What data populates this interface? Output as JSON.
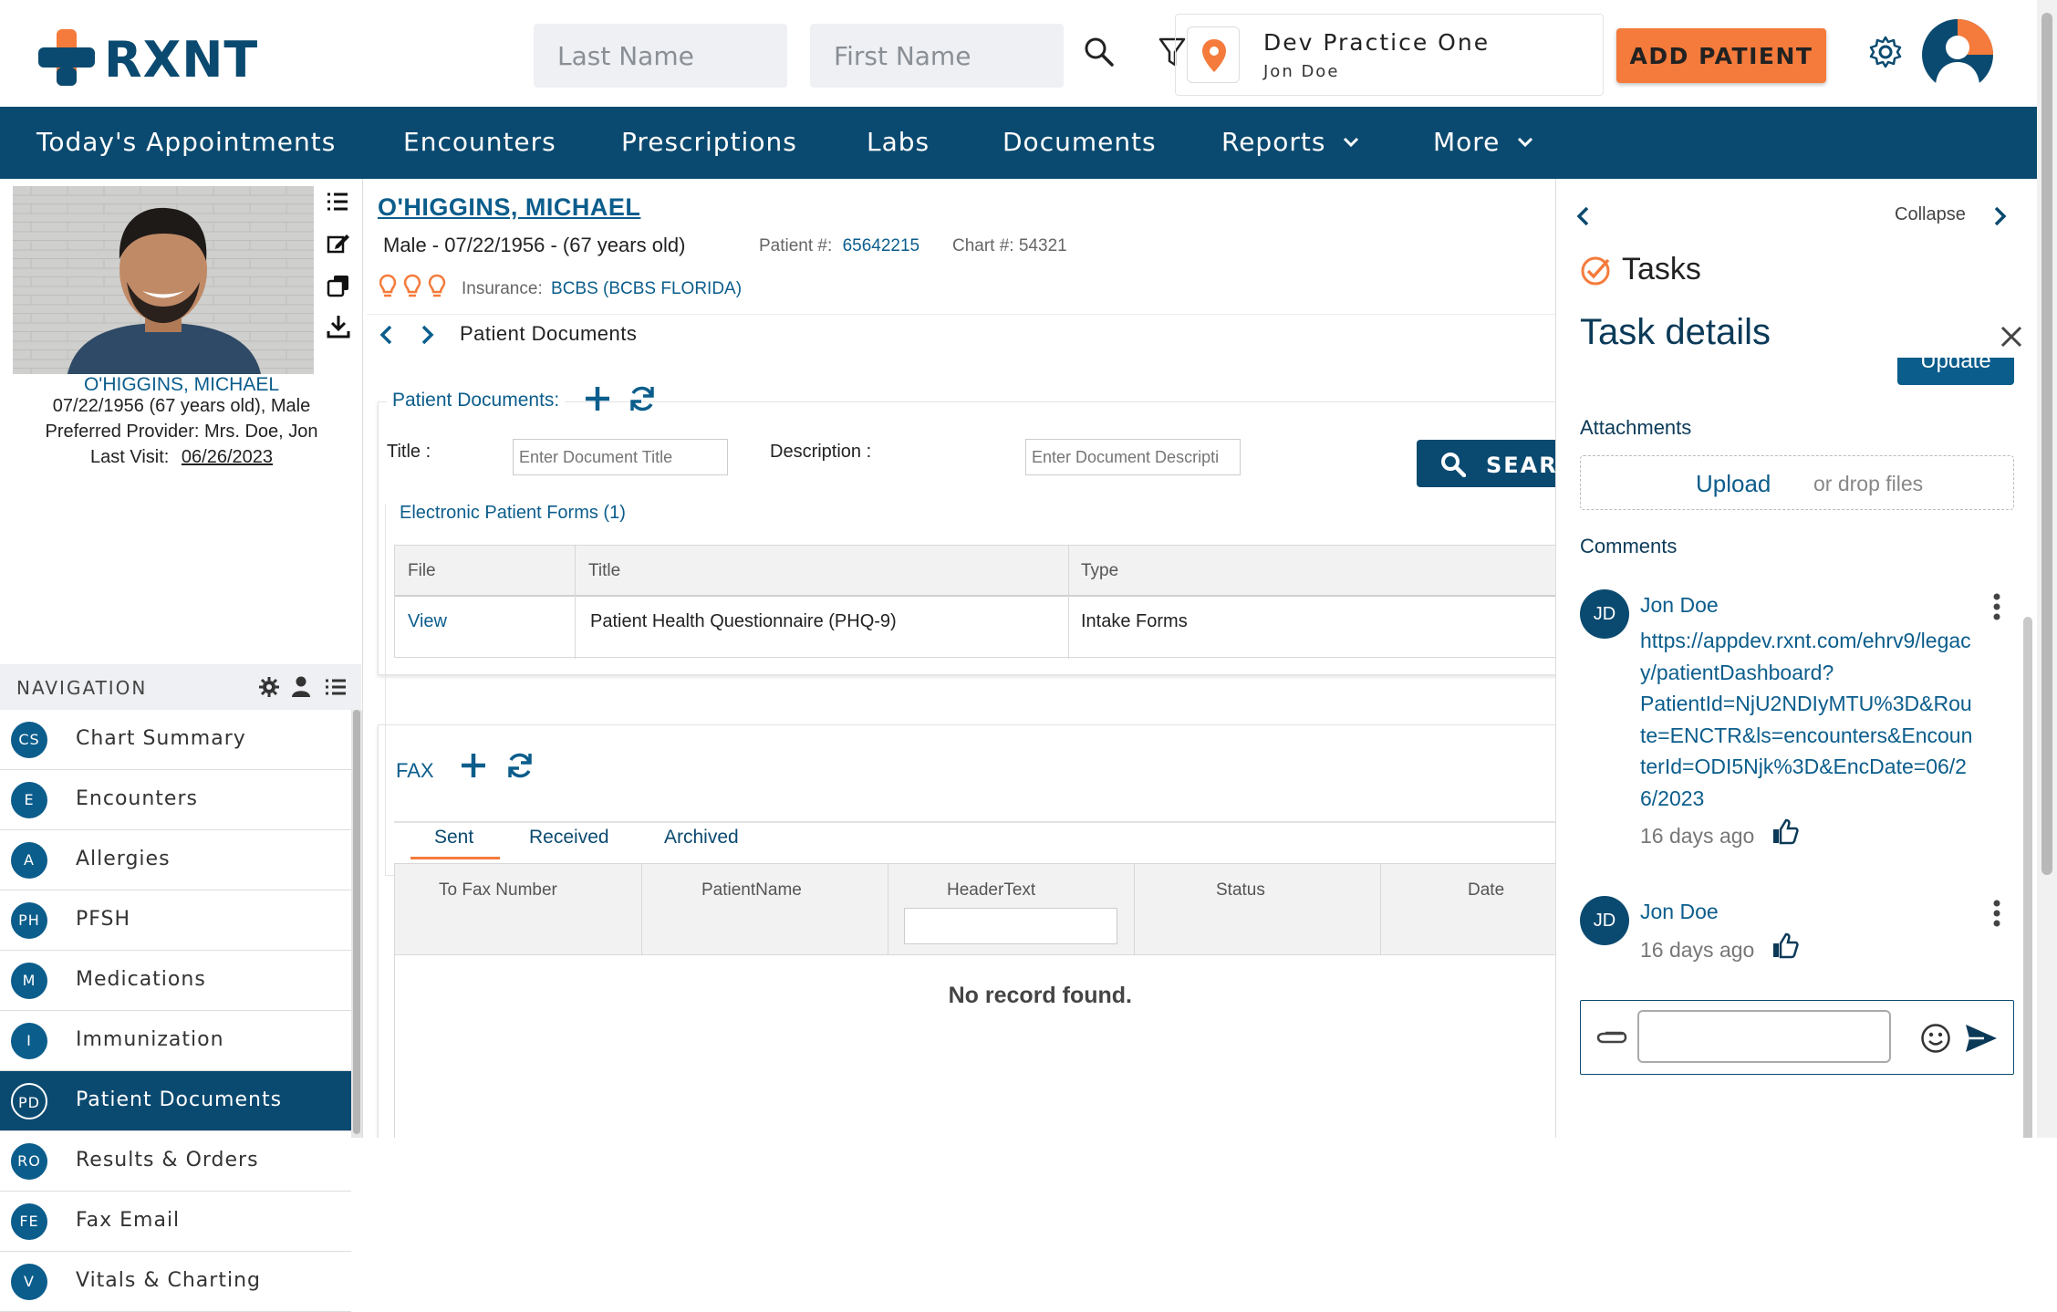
{
  "header": {
    "logo_text": "RXNT",
    "last_name_placeholder": "Last Name",
    "first_name_placeholder": "First Name",
    "practice_name": "Dev Practice One",
    "practice_user": "Jon Doe",
    "add_patient_label": "ADD PATIENT"
  },
  "nav": {
    "items": [
      "Today's Appointments",
      "Encounters",
      "Prescriptions",
      "Labs",
      "Documents",
      "Reports",
      "More"
    ]
  },
  "patient": {
    "name": "O'HIGGINS, MICHAEL",
    "card_name": "O'HIGGINS, MICHAEL",
    "dob_age_sex": "07/22/1956 (67 years old), Male",
    "preferred_provider": "Preferred Provider: Mrs. Doe, Jon",
    "last_visit_label": "Last Visit:",
    "last_visit_date": "06/26/2023",
    "demographics": "Male - 07/22/1956 - (67 years old)",
    "patient_num_label": "Patient #:",
    "patient_num": "65642215",
    "chart_num": "Chart #: 54321",
    "insurance_label": "Insurance:",
    "insurance_value": "BCBS (BCBS FLORIDA)"
  },
  "left_nav": {
    "heading": "NAVIGATION",
    "items": [
      {
        "abbr": "CS",
        "label": "Chart Summary"
      },
      {
        "abbr": "E",
        "label": "Encounters"
      },
      {
        "abbr": "A",
        "label": "Allergies"
      },
      {
        "abbr": "PH",
        "label": "PFSH"
      },
      {
        "abbr": "M",
        "label": "Medications"
      },
      {
        "abbr": "I",
        "label": "Immunization"
      },
      {
        "abbr": "PD",
        "label": "Patient Documents"
      },
      {
        "abbr": "RO",
        "label": "Results & Orders"
      },
      {
        "abbr": "FE",
        "label": "Fax Email"
      },
      {
        "abbr": "V",
        "label": "Vitals & Charting"
      }
    ]
  },
  "documents": {
    "breadcrumb": "Patient Documents",
    "section_title": "Patient Documents:",
    "title_label": "Title :",
    "title_placeholder": "Enter Document Title",
    "description_label": "Description :",
    "description_placeholder": "Enter Document Descripti",
    "search_label": "SEARC",
    "forms_heading": "Electronic Patient Forms (1)",
    "columns": [
      "File",
      "Title",
      "Type"
    ],
    "rows": [
      {
        "file": "View",
        "title": "Patient Health Questionnaire (PHQ-9)",
        "type": "Intake Forms"
      }
    ]
  },
  "fax": {
    "title": "FAX",
    "tabs": [
      "Sent",
      "Received",
      "Archived"
    ],
    "columns": [
      "To Fax Number",
      "PatientName",
      "HeaderText",
      "Status",
      "Date"
    ],
    "empty": "No record found."
  },
  "tasks": {
    "collapse_label": "Collapse",
    "title": "Tasks",
    "details_title": "Task details",
    "update_label": "Update",
    "attachments_label": "Attachments",
    "upload_label": "Upload",
    "drop_label": "or drop files",
    "comments_label": "Comments",
    "comments": [
      {
        "initials": "JD",
        "author": "Jon Doe",
        "lines": [
          "https://appdev.rxnt.com/ehrv9/legac",
          "y/patientDashboard?",
          "PatientId=NjU2NDIyMTU%3D&Rou",
          "te=ENCTR&ls=encounters&Encoun",
          "terId=ODI5Njk%3D&EncDate=06/2",
          "6/2023"
        ],
        "time": "16 days ago"
      },
      {
        "initials": "JD",
        "author": "Jon Doe",
        "lines": [],
        "time": "16 days ago"
      }
    ]
  },
  "colors": {
    "brand_blue": "#0b4a70",
    "accent_orange": "#f47b3b",
    "link_blue": "#0b5d8c"
  }
}
